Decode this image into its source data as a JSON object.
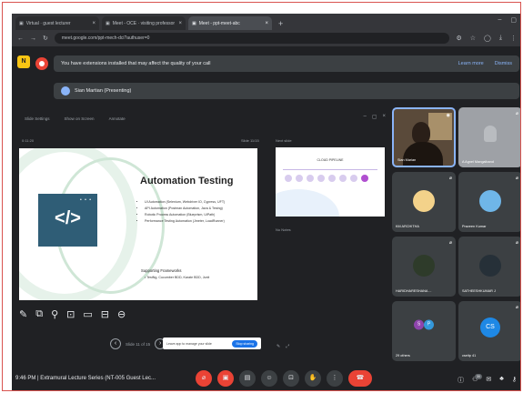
{
  "browser": {
    "tabs": [
      {
        "label": "Virtual · guest lecturer",
        "active": false
      },
      {
        "label": "Meet - OCE · visiting professor",
        "active": false
      },
      {
        "label": "Meet - ppt-meet-abc",
        "active": true
      }
    ],
    "url": "meet.google.com/ppt-mech-dci?authuser=0"
  },
  "meet": {
    "extension_warning": "You have extensions installed that may affect the quality of your call",
    "learn_more": "Learn more",
    "dismiss": "Dismiss",
    "presenter_banner": "Sian Martian (Presenting)",
    "side_badge": "N"
  },
  "presentation": {
    "toolbar": [
      "Slide Settings",
      "Show on Screen",
      "Annotate"
    ],
    "slide_meta_left": "0:11:20",
    "slide_meta_right": "Slide 11/15",
    "slide": {
      "title": "Automation Testing",
      "code_symbol": "</>",
      "bullets": [
        "UI Automation (Selenium, Webdriver IO, Cypress, UFT)",
        "API Automation (Postman Automation, Java & Testng)",
        "Robotic Process Automation (Blueprism, UiPath)",
        "Performance Testing Automation (Jmeter, LoadRunner)"
      ],
      "sub_heading": "Supporting Frameworks",
      "sub_item": "• TestNg, Cucumber BDD, Karate BDD, Junit"
    },
    "nav_label": "Slide 11 of 15",
    "toast_text": "Leave app to manage your slide",
    "toast_button": "Stop sharing",
    "next_label": "Next slide",
    "next_slide_title": "CLOUD PIPELINE",
    "notes_label": "No Notes"
  },
  "participants": [
    {
      "name": "Sian Marian",
      "kind": "video"
    },
    {
      "name": "A Agnel Mangaiband",
      "kind": "avatar-grey"
    },
    {
      "name": "KM ARCHITHA",
      "kind": "avatar",
      "color": "#f3d28a"
    },
    {
      "name": "Praveen Kumar",
      "kind": "avatar",
      "color": "#6fb6e8"
    },
    {
      "name": "HARIDHARESHANA ...",
      "kind": "avatar",
      "color": "#2e3b2a"
    },
    {
      "name": "SATHEESHKUMAR J",
      "kind": "avatar",
      "color": "#263038"
    },
    {
      "name": "29 others",
      "kind": "pair"
    },
    {
      "name": "cseitp 41",
      "kind": "initials",
      "initials": "CS"
    }
  ],
  "controls": {
    "time": "9:46 PM",
    "meeting_title": "Extramural Lecture Series (NT-005 Guest Lec...",
    "people_badge": "30"
  }
}
